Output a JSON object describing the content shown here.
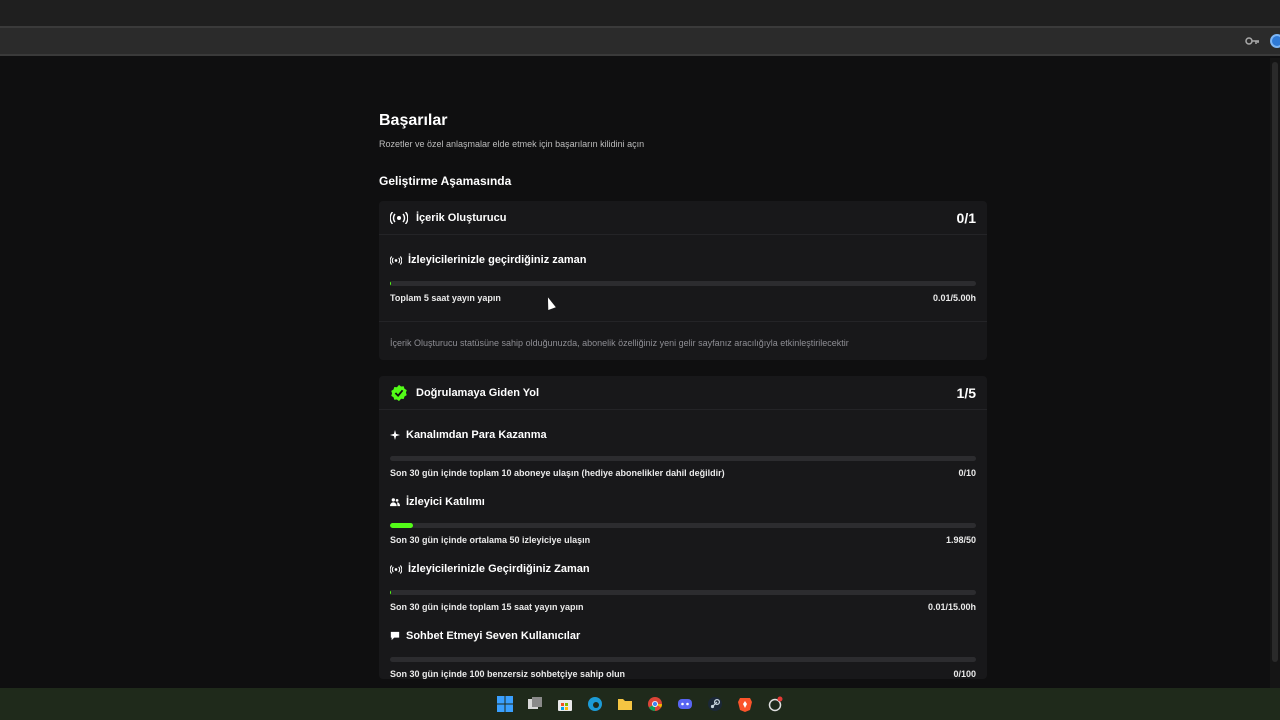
{
  "page": {
    "title": "Başarılar",
    "subtitle": "Rozetler ve özel anlaşmalar elde etmek için başarıların kilidini açın",
    "section_title": "Geliştirme Aşamasında"
  },
  "cards": [
    {
      "title": "İçerik Oluşturucu",
      "count": "0/1",
      "icon": "broadcast-icon",
      "tasks": [
        {
          "title": "İzleyicilerinizle geçirdiğiniz zaman",
          "icon": "broadcast-icon",
          "desc": "Toplam 5 saat yayın yapın",
          "value": "0.01/5.00h",
          "progress": 0.002
        }
      ],
      "note": "İçerik Oluşturucu statüsüne sahip olduğunuzda, abonelik özelliğiniz yeni gelir sayfanız aracılığıyla etkinleştirilecektir"
    },
    {
      "title": "Doğrulamaya Giden Yol",
      "count": "1/5",
      "icon": "verified-badge-icon",
      "tasks": [
        {
          "title": "Kanalımdan Para Kazanma",
          "icon": "sparkle-icon",
          "desc": "Son 30 gün içinde toplam 10 aboneye ulaşın (hediye abonelikler dahil değildir)",
          "value": "0/10",
          "progress": 0
        },
        {
          "title": "İzleyici Katılımı",
          "icon": "users-icon",
          "desc": "Son 30 gün içinde ortalama 50 izleyiciye ulaşın",
          "value": "1.98/50",
          "progress": 0.0396
        },
        {
          "title": "İzleyicilerinizle Geçirdiğiniz Zaman",
          "icon": "broadcast-icon",
          "desc": "Son 30 gün içinde toplam 15 saat yayın yapın",
          "value": "0.01/15.00h",
          "progress": 0.001
        },
        {
          "title": "Sohbet Etmeyi Seven Kullanıcılar",
          "icon": "chat-icon",
          "desc": "Son 30 gün içinde 100 benzersiz sohbetçiye sahip olun",
          "value": "0/100",
          "progress": 0
        }
      ]
    }
  ],
  "colors": {
    "accent": "#53fc18",
    "background": "#0f0f10",
    "card": "#18181a"
  },
  "taskbar": [
    "windows-start-icon",
    "task-view-icon",
    "store-icon",
    "edge-icon",
    "file-explorer-icon",
    "chrome-icon",
    "discord-icon",
    "steam-icon",
    "brave-icon",
    "app-icon"
  ]
}
